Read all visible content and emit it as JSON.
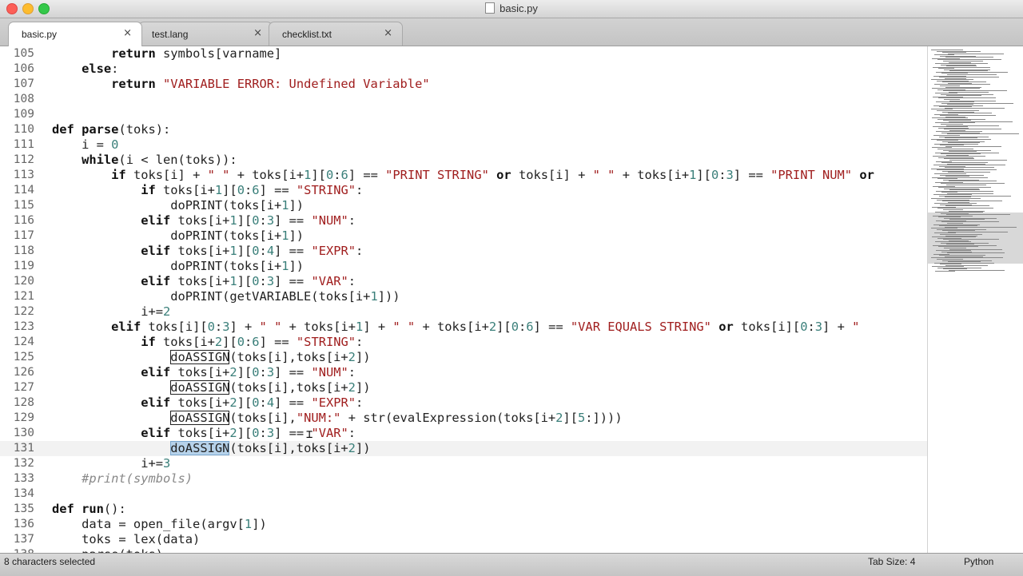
{
  "window": {
    "title": "basic.py"
  },
  "tabs": [
    {
      "label": "basic.py",
      "close": "×",
      "active": true
    },
    {
      "label": "test.lang",
      "close": "×",
      "active": false
    },
    {
      "label": "checklist.txt",
      "close": "×",
      "active": false
    }
  ],
  "editor": {
    "lines": [
      {
        "n": "105",
        "code": [
          {
            "t": "        "
          },
          {
            "t": "return",
            "c": "kw"
          },
          {
            "t": " symbols[varname]"
          }
        ]
      },
      {
        "n": "106",
        "code": [
          {
            "t": "    "
          },
          {
            "t": "else",
            "c": "kw"
          },
          {
            "t": ":"
          }
        ]
      },
      {
        "n": "107",
        "code": [
          {
            "t": "        "
          },
          {
            "t": "return",
            "c": "kw"
          },
          {
            "t": " "
          },
          {
            "t": "\"VARIABLE ERROR: Undefined Variable\"",
            "c": "str"
          }
        ]
      },
      {
        "n": "108",
        "code": []
      },
      {
        "n": "109",
        "code": []
      },
      {
        "n": "110",
        "code": [
          {
            "t": "def",
            "c": "kw"
          },
          {
            "t": " "
          },
          {
            "t": "parse",
            "c": "fn"
          },
          {
            "t": "(toks):"
          }
        ]
      },
      {
        "n": "111",
        "code": [
          {
            "t": "    i = "
          },
          {
            "t": "0",
            "c": "num"
          }
        ]
      },
      {
        "n": "112",
        "code": [
          {
            "t": "    "
          },
          {
            "t": "while",
            "c": "kw"
          },
          {
            "t": "(i < len(toks)):"
          }
        ]
      },
      {
        "n": "113",
        "code": [
          {
            "t": "        "
          },
          {
            "t": "if",
            "c": "kw"
          },
          {
            "t": " toks[i] + "
          },
          {
            "t": "\" \"",
            "c": "str"
          },
          {
            "t": " + toks[i+"
          },
          {
            "t": "1",
            "c": "num"
          },
          {
            "t": "]["
          },
          {
            "t": "0",
            "c": "num"
          },
          {
            "t": ":"
          },
          {
            "t": "6",
            "c": "num"
          },
          {
            "t": "] == "
          },
          {
            "t": "\"PRINT STRING\"",
            "c": "str"
          },
          {
            "t": " "
          },
          {
            "t": "or",
            "c": "kw"
          },
          {
            "t": " toks[i] + "
          },
          {
            "t": "\" \"",
            "c": "str"
          },
          {
            "t": " + toks[i+"
          },
          {
            "t": "1",
            "c": "num"
          },
          {
            "t": "]["
          },
          {
            "t": "0",
            "c": "num"
          },
          {
            "t": ":"
          },
          {
            "t": "3",
            "c": "num"
          },
          {
            "t": "] == "
          },
          {
            "t": "\"PRINT NUM\"",
            "c": "str"
          },
          {
            "t": " "
          },
          {
            "t": "or",
            "c": "kw"
          }
        ]
      },
      {
        "n": "114",
        "code": [
          {
            "t": "            "
          },
          {
            "t": "if",
            "c": "kw"
          },
          {
            "t": " toks[i+"
          },
          {
            "t": "1",
            "c": "num"
          },
          {
            "t": "]["
          },
          {
            "t": "0",
            "c": "num"
          },
          {
            "t": ":"
          },
          {
            "t": "6",
            "c": "num"
          },
          {
            "t": "] == "
          },
          {
            "t": "\"STRING\"",
            "c": "str"
          },
          {
            "t": ":"
          }
        ]
      },
      {
        "n": "115",
        "code": [
          {
            "t": "                doPRINT(toks[i+"
          },
          {
            "t": "1",
            "c": "num"
          },
          {
            "t": "])"
          }
        ]
      },
      {
        "n": "116",
        "code": [
          {
            "t": "            "
          },
          {
            "t": "elif",
            "c": "kw"
          },
          {
            "t": " toks[i+"
          },
          {
            "t": "1",
            "c": "num"
          },
          {
            "t": "]["
          },
          {
            "t": "0",
            "c": "num"
          },
          {
            "t": ":"
          },
          {
            "t": "3",
            "c": "num"
          },
          {
            "t": "] == "
          },
          {
            "t": "\"NUM\"",
            "c": "str"
          },
          {
            "t": ":"
          }
        ]
      },
      {
        "n": "117",
        "code": [
          {
            "t": "                doPRINT(toks[i+"
          },
          {
            "t": "1",
            "c": "num"
          },
          {
            "t": "])"
          }
        ]
      },
      {
        "n": "118",
        "code": [
          {
            "t": "            "
          },
          {
            "t": "elif",
            "c": "kw"
          },
          {
            "t": " toks[i+"
          },
          {
            "t": "1",
            "c": "num"
          },
          {
            "t": "]["
          },
          {
            "t": "0",
            "c": "num"
          },
          {
            "t": ":"
          },
          {
            "t": "4",
            "c": "num"
          },
          {
            "t": "] == "
          },
          {
            "t": "\"EXPR\"",
            "c": "str"
          },
          {
            "t": ":"
          }
        ]
      },
      {
        "n": "119",
        "code": [
          {
            "t": "                doPRINT(toks[i+"
          },
          {
            "t": "1",
            "c": "num"
          },
          {
            "t": "])"
          }
        ]
      },
      {
        "n": "120",
        "code": [
          {
            "t": "            "
          },
          {
            "t": "elif",
            "c": "kw"
          },
          {
            "t": " toks[i+"
          },
          {
            "t": "1",
            "c": "num"
          },
          {
            "t": "]["
          },
          {
            "t": "0",
            "c": "num"
          },
          {
            "t": ":"
          },
          {
            "t": "3",
            "c": "num"
          },
          {
            "t": "] == "
          },
          {
            "t": "\"VAR\"",
            "c": "str"
          },
          {
            "t": ":"
          }
        ]
      },
      {
        "n": "121",
        "code": [
          {
            "t": "                doPRINT(getVARIABLE(toks[i+"
          },
          {
            "t": "1",
            "c": "num"
          },
          {
            "t": "]))"
          }
        ]
      },
      {
        "n": "122",
        "code": [
          {
            "t": "            i+="
          },
          {
            "t": "2",
            "c": "num"
          }
        ]
      },
      {
        "n": "123",
        "code": [
          {
            "t": "        "
          },
          {
            "t": "elif",
            "c": "kw"
          },
          {
            "t": " toks[i]["
          },
          {
            "t": "0",
            "c": "num"
          },
          {
            "t": ":"
          },
          {
            "t": "3",
            "c": "num"
          },
          {
            "t": "] + "
          },
          {
            "t": "\" \"",
            "c": "str"
          },
          {
            "t": " + toks[i+"
          },
          {
            "t": "1",
            "c": "num"
          },
          {
            "t": "] + "
          },
          {
            "t": "\" \"",
            "c": "str"
          },
          {
            "t": " + toks[i+"
          },
          {
            "t": "2",
            "c": "num"
          },
          {
            "t": "]["
          },
          {
            "t": "0",
            "c": "num"
          },
          {
            "t": ":"
          },
          {
            "t": "6",
            "c": "num"
          },
          {
            "t": "] == "
          },
          {
            "t": "\"VAR EQUALS STRING\"",
            "c": "str"
          },
          {
            "t": " "
          },
          {
            "t": "or",
            "c": "kw"
          },
          {
            "t": " toks[i]["
          },
          {
            "t": "0",
            "c": "num"
          },
          {
            "t": ":"
          },
          {
            "t": "3",
            "c": "num"
          },
          {
            "t": "] + "
          },
          {
            "t": "\"",
            "c": "str"
          }
        ]
      },
      {
        "n": "124",
        "code": [
          {
            "t": "            "
          },
          {
            "t": "if",
            "c": "kw"
          },
          {
            "t": " toks[i+"
          },
          {
            "t": "2",
            "c": "num"
          },
          {
            "t": "]["
          },
          {
            "t": "0",
            "c": "num"
          },
          {
            "t": ":"
          },
          {
            "t": "6",
            "c": "num"
          },
          {
            "t": "] == "
          },
          {
            "t": "\"STRING\"",
            "c": "str"
          },
          {
            "t": ":"
          }
        ]
      },
      {
        "n": "125",
        "code": [
          {
            "t": "                "
          },
          {
            "t": "doASSIGN",
            "c": "box"
          },
          {
            "t": "(toks[i],toks[i+"
          },
          {
            "t": "2",
            "c": "num"
          },
          {
            "t": "])"
          }
        ]
      },
      {
        "n": "126",
        "code": [
          {
            "t": "            "
          },
          {
            "t": "elif",
            "c": "kw"
          },
          {
            "t": " toks[i+"
          },
          {
            "t": "2",
            "c": "num"
          },
          {
            "t": "]["
          },
          {
            "t": "0",
            "c": "num"
          },
          {
            "t": ":"
          },
          {
            "t": "3",
            "c": "num"
          },
          {
            "t": "] == "
          },
          {
            "t": "\"NUM\"",
            "c": "str"
          },
          {
            "t": ":"
          }
        ]
      },
      {
        "n": "127",
        "code": [
          {
            "t": "                "
          },
          {
            "t": "doASSIGN",
            "c": "box"
          },
          {
            "t": "(toks[i],toks[i+"
          },
          {
            "t": "2",
            "c": "num"
          },
          {
            "t": "])"
          }
        ]
      },
      {
        "n": "128",
        "code": [
          {
            "t": "            "
          },
          {
            "t": "elif",
            "c": "kw"
          },
          {
            "t": " toks[i+"
          },
          {
            "t": "2",
            "c": "num"
          },
          {
            "t": "]["
          },
          {
            "t": "0",
            "c": "num"
          },
          {
            "t": ":"
          },
          {
            "t": "4",
            "c": "num"
          },
          {
            "t": "] == "
          },
          {
            "t": "\"EXPR\"",
            "c": "str"
          },
          {
            "t": ":"
          }
        ]
      },
      {
        "n": "129",
        "code": [
          {
            "t": "                "
          },
          {
            "t": "doASSIGN",
            "c": "box"
          },
          {
            "t": "(toks[i],"
          },
          {
            "t": "\"NUM:\"",
            "c": "str"
          },
          {
            "t": " + str(evalExpression(toks[i+"
          },
          {
            "t": "2",
            "c": "num"
          },
          {
            "t": "]["
          },
          {
            "t": "5",
            "c": "num"
          },
          {
            "t": ":])))"
          }
        ]
      },
      {
        "n": "130",
        "code": [
          {
            "t": "            "
          },
          {
            "t": "elif",
            "c": "kw"
          },
          {
            "t": " toks[i+"
          },
          {
            "t": "2",
            "c": "num"
          },
          {
            "t": "]["
          },
          {
            "t": "0",
            "c": "num"
          },
          {
            "t": ":"
          },
          {
            "t": "3",
            "c": "num"
          },
          {
            "t": "] == "
          },
          {
            "t": "\"VAR\"",
            "c": "str"
          },
          {
            "t": ":"
          }
        ]
      },
      {
        "n": "131",
        "current": true,
        "code": [
          {
            "t": "                "
          },
          {
            "t": "doASSIGN",
            "c": "sel"
          },
          {
            "t": "(toks[i],toks[i+"
          },
          {
            "t": "2",
            "c": "num"
          },
          {
            "t": "])"
          }
        ]
      },
      {
        "n": "132",
        "code": [
          {
            "t": "            i+="
          },
          {
            "t": "3",
            "c": "num"
          }
        ]
      },
      {
        "n": "133",
        "code": [
          {
            "t": "    "
          },
          {
            "t": "#print(symbols)",
            "c": "cm"
          }
        ]
      },
      {
        "n": "134",
        "code": []
      },
      {
        "n": "135",
        "code": [
          {
            "t": "def",
            "c": "kw"
          },
          {
            "t": " "
          },
          {
            "t": "run",
            "c": "fn"
          },
          {
            "t": "():"
          }
        ]
      },
      {
        "n": "136",
        "code": [
          {
            "t": "    data = open_file(argv["
          },
          {
            "t": "1",
            "c": "num"
          },
          {
            "t": "])"
          }
        ]
      },
      {
        "n": "137",
        "code": [
          {
            "t": "    toks = lex(data)"
          }
        ]
      },
      {
        "n": "138",
        "code": [
          {
            "t": "    parse(toks)"
          }
        ]
      }
    ]
  },
  "status": {
    "selection": "8 characters selected",
    "tab_size": "Tab Size: 4",
    "language": "Python"
  }
}
